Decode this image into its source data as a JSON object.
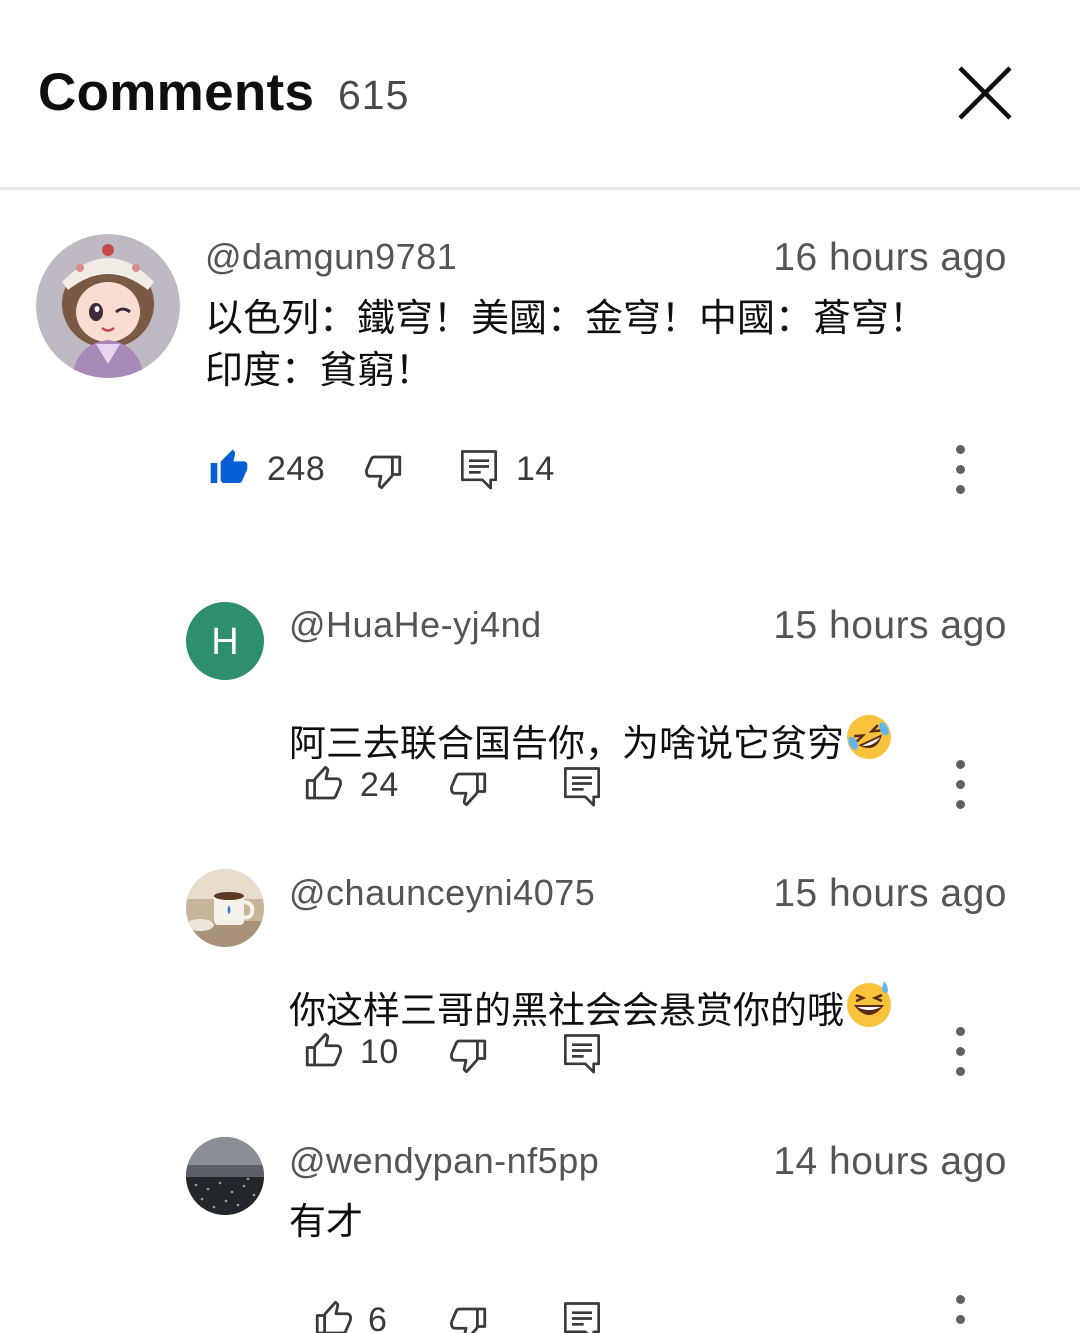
{
  "header": {
    "title": "Comments",
    "count": "615"
  },
  "comments": [
    {
      "author": "@damgun9781",
      "time": "16 hours ago",
      "text": "以色列：鐵穹！美國：金穹！中國：蒼穹！\n印度：貧窮！",
      "likes": "248",
      "replies": "14",
      "liked": true
    },
    {
      "author": "@HuaHe-yj4nd",
      "avatar_letter": "H",
      "time": "15 hours ago",
      "text": "阿三去联合国告你，为啥说它贫穷",
      "emoji": "rolling-on-floor-laughing-icon",
      "likes": "24"
    },
    {
      "author": "@chaunceyni4075",
      "time": "15 hours ago",
      "text": "你这样三哥的黑社会会悬赏你的哦",
      "emoji": "grinning-sweat-icon",
      "likes": "10"
    },
    {
      "author": "@wendypan-nf5pp",
      "time": "14 hours ago",
      "text": "有才",
      "likes": "6"
    }
  ],
  "colors": {
    "avatar_h_bg": "#2e8f6c",
    "like_active": "#065fd4",
    "text_secondary": "#555555"
  }
}
